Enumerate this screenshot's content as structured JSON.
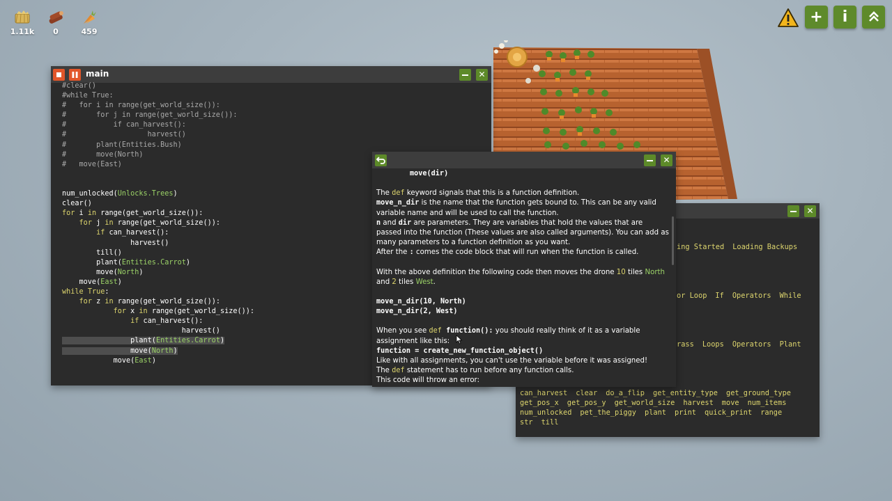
{
  "resources": [
    {
      "name": "hay",
      "value": "1.11k",
      "icon": "hay-icon"
    },
    {
      "name": "wood",
      "value": "0",
      "icon": "wood-icon"
    },
    {
      "name": "carrot",
      "value": "459",
      "icon": "carrot-icon"
    }
  ],
  "top_buttons": {
    "warning": "warning-icon",
    "add": "+",
    "info": "i",
    "up": "chevrons-up-icon"
  },
  "editor": {
    "title": "main",
    "lines": [
      "#clear()",
      "#while True:",
      "#   for i in range(get_world_size()):",
      "#       for j in range(get_world_size()):",
      "#           if can_harvest():",
      "#                   harvest()",
      "#       plant(Entities.Bush)",
      "#       move(North)",
      "#   move(East)",
      "",
      "",
      "num_unlocked(Unlocks.Trees)",
      "clear()",
      "for i in range(get_world_size()):",
      "    for j in range(get_world_size()):",
      "        if can_harvest():",
      "                harvest()",
      "        till()",
      "        plant(Entities.Carrot)",
      "        move(North)",
      "    move(East)",
      "while True:",
      "    for z in range(get_world_size()):",
      "            for x in range(get_world_size()):",
      "                if can_harvest():",
      "                            harvest()",
      "                plant(Entities.Carrot)",
      "                move(North)",
      "            move(East)"
    ]
  },
  "docs": {
    "header_code": "move(dir)",
    "p1_def": "def",
    "p1_text": " keyword signals that this is a function definition.",
    "p1_the": "The ",
    "p2_name": "move_n_dir",
    "p2_text": " is the name that the function gets bound to. This can be any valid variable name and will be used to call the function.",
    "p3_n": "n",
    "p3_and": " and ",
    "p3_dir": "dir",
    "p3_text": " are parameters. They are variables that hold the values that are passed into the function (These values are also called arguments). You can add as many parameters to a function definition as you want.",
    "p4_a": "After the ",
    "p4_colon": ":",
    "p4_b": " comes the code block that will run when the function is called.",
    "p5_a": "With the above definition the following code then moves the drone ",
    "p5_10": "10",
    "p5_tiles": " tiles ",
    "p5_north": "North",
    "p5_and": "and ",
    "p5_2": "2",
    "p5_tiles2": " tiles ",
    "p5_west": "West",
    "p5_end": ".",
    "code1": "move_n_dir(10, North)",
    "code2": "move_n_dir(2, West)",
    "p6_a": "When you see ",
    "p6_def": "def",
    "p6_fn": " function():",
    "p6_b": " you should really think of it as a variable assignment like this:",
    "code3": "function = create_new_function_object()",
    "p7": "Like with all assignments, you can't use the variable before it was assigned!",
    "p8_a": "The ",
    "p8_def": "def",
    "p8_b": " statement has to run before any function calls.",
    "p9": "This code will throw an error:"
  },
  "links": {
    "row1": [
      "ing Started",
      "Loading Backups"
    ],
    "row2": [
      "or Loop",
      "If",
      "Operators",
      "While"
    ],
    "row3": [
      "rass",
      "Loops",
      "Operators",
      "Plant"
    ],
    "row4": [
      "can_harvest",
      "clear",
      "do_a_flip",
      "get_entity_type",
      "get_ground_type"
    ],
    "row5": [
      "get_pos_x",
      "get_pos_y",
      "get_world_size",
      "harvest",
      "move",
      "num_items"
    ],
    "row6": [
      "num_unlocked",
      "pet_the_piggy",
      "plant",
      "print",
      "quick_print",
      "range"
    ],
    "row7": [
      "str",
      "till"
    ]
  },
  "colors": {
    "accent_green": "#5e8a2b",
    "close_red": "#e2562a",
    "keyword_yellow": "#dcd46d",
    "entity_green": "#9bd267",
    "window_bg": "#2b2b2b"
  }
}
